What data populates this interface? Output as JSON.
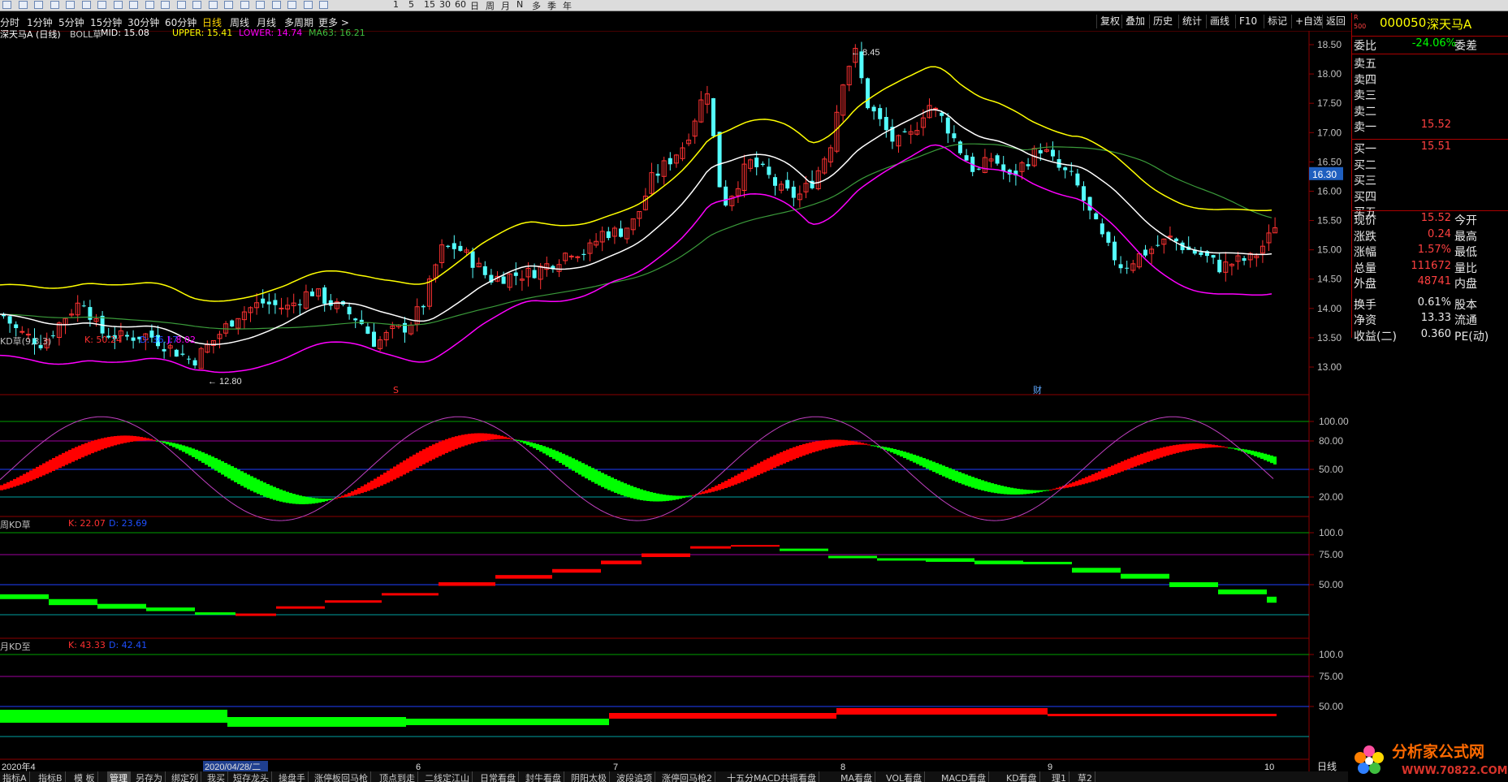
{
  "toolbar": {
    "icons": [
      "arrow-icon",
      "back-icon",
      "zoom-in-icon",
      "zoom-out-icon",
      "line-icon",
      "bar-chart-icon",
      "candle-icon",
      "grid-icon",
      "grid2-icon",
      "grid3-icon",
      "grid4-icon",
      "doc-icon",
      "doc2-icon",
      "screen-icon",
      "cycle-icon",
      "kline-icon",
      "rsi-icon",
      "crosshair-icon",
      "pen-icon",
      "list-icon",
      "tools-icon"
    ],
    "periods_small": [
      "1",
      "5",
      "15",
      "30",
      "60",
      "日",
      "周",
      "月",
      "N",
      "多",
      "季",
      "年"
    ]
  },
  "period_tabs": {
    "items": [
      {
        "label": "分时",
        "active": false
      },
      {
        "label": "1分钟",
        "active": false
      },
      {
        "label": "5分钟",
        "active": false
      },
      {
        "label": "15分钟",
        "active": false
      },
      {
        "label": "30分钟",
        "active": false
      },
      {
        "label": "60分钟",
        "active": false
      },
      {
        "label": "日线",
        "active": true
      },
      {
        "label": "周线",
        "active": false
      },
      {
        "label": "月线",
        "active": false
      },
      {
        "label": "多周期",
        "active": false
      },
      {
        "label": "更多 >",
        "active": false
      }
    ],
    "right_buttons": [
      "复权",
      "叠加",
      "历史",
      "统计",
      "画线",
      "F10",
      "标记",
      "+自选",
      "返回"
    ]
  },
  "main_panel": {
    "stock_title": "深天马A (日线)",
    "indicator": "BOLL草",
    "mid": "MID: 15.08",
    "upper": "UPPER: 15.41",
    "lower": "LOWER: 14.74",
    "ma63": "MA63: 16.21",
    "high_marker": "8.45",
    "low_marker": "12.80",
    "price_label_current": "16.30",
    "y_ticks": [
      "18.50",
      "18.00",
      "17.50",
      "17.00",
      "16.50",
      "16.00",
      "15.50",
      "15.00",
      "14.50",
      "14.00",
      "13.50",
      "13.00"
    ],
    "event_markers": [
      "S",
      "财"
    ]
  },
  "kd_panel": {
    "name": "KD草(9,3,3)",
    "k": "K: 50.24",
    "d": "D: 36.17",
    "j": "J: 8.02",
    "ticks": [
      "100.00",
      "80.00",
      "50.00",
      "20.00"
    ]
  },
  "week_kd_panel": {
    "name": "周KD草",
    "k": "K: 22.07",
    "d": "D: 23.69",
    "ticks": [
      "100.0",
      "75.00",
      "50.00"
    ]
  },
  "month_kd_panel": {
    "name": "月KD至",
    "k": "K: 43.33",
    "d": "D: 42.41",
    "ticks": [
      "100.0",
      "75.00",
      "50.00"
    ]
  },
  "x_axis": {
    "labels": [
      "2020年4",
      "2020/04/28/二",
      "6",
      "7",
      "8",
      "9",
      "10"
    ],
    "right_label": "日线"
  },
  "quote_panel": {
    "code": "000050",
    "name": "深天马A",
    "small_tag": "R 500",
    "weibi_label": "委比",
    "weibi_value": "-24.06%",
    "weicha_label": "委差",
    "sell": [
      "卖五",
      "卖四",
      "卖三",
      "卖二",
      "卖一"
    ],
    "sell_one_price": "15.52",
    "buy": [
      "买一",
      "买二",
      "买三",
      "买四",
      "买五"
    ],
    "buy_one_price": "15.51",
    "stats": [
      {
        "k": "现价",
        "v": "15.52",
        "k2": "今开"
      },
      {
        "k": "涨跌",
        "v": "0.24",
        "k2": "最高"
      },
      {
        "k": "涨幅",
        "v": "1.57%",
        "k2": "最低"
      },
      {
        "k": "总量",
        "v": "111672",
        "k2": "量比"
      },
      {
        "k": "外盘",
        "v": "48741",
        "k2": "内盘"
      },
      {
        "k": "换手",
        "v": "0.61%",
        "k2": "股本"
      },
      {
        "k": "净资",
        "v": "13.33",
        "k2": "流通"
      },
      {
        "k": "收益(二)",
        "v": "0.360",
        "k2": "PE(动)"
      }
    ]
  },
  "bottom_tabs": [
    "指标A",
    "指标B",
    "模 板",
    "管理",
    "另存为",
    "绑定列",
    "我买",
    "短存龙头",
    "操盘手",
    "涨停板回马枪",
    "顶点到走",
    "二线定江山",
    "日常看盘",
    "封牛看盘",
    "阴阳太极",
    "波段追项",
    "涨停回马枪2",
    "十五分MACD共振看盘",
    "MA看盘",
    "VOL看盘",
    "MACD看盘",
    "KD看盘",
    "理1",
    "草2"
  ],
  "bottom_tab_active": "管理",
  "logo": {
    "text": "分析家公式网",
    "url": "WWW.70822.COM"
  },
  "colors": {
    "up": "#ff3232",
    "down": "#54ffff",
    "upper": "#ffff00",
    "mid": "#ffffff",
    "lower": "#ff00ff",
    "ma63": "#3a9a3a",
    "kdred": "#ff0000",
    "kdgreen": "#00ff00",
    "grid_red": "#8b0000",
    "quote_red": "#ff3030"
  }
}
